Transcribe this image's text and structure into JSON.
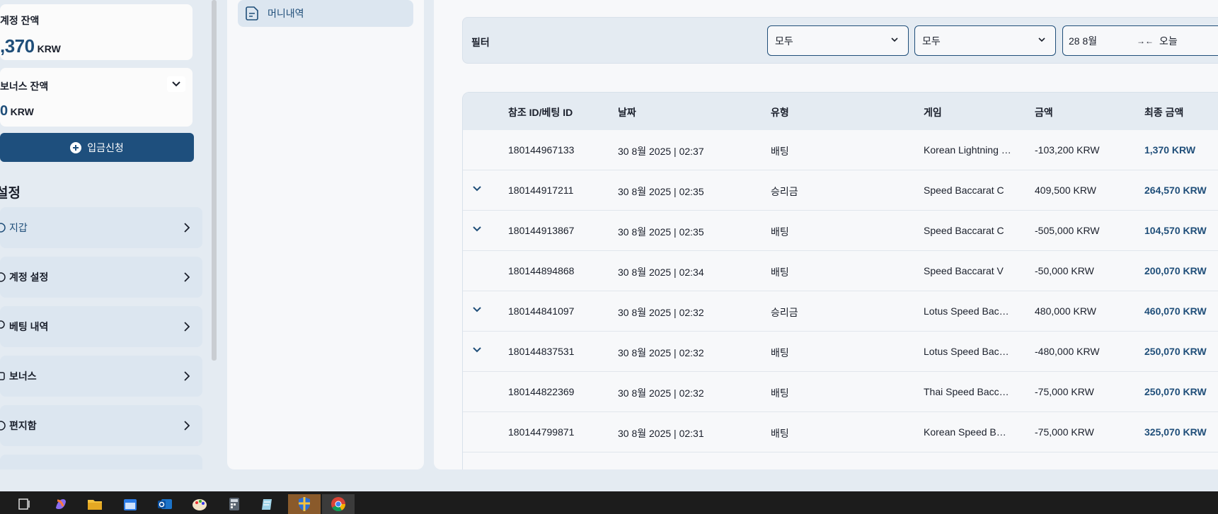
{
  "account": {
    "balance_label": "계정 잔액",
    "balance_value": ",370",
    "currency": "KRW",
    "bonus_label": "보너스 잔액",
    "bonus_value": "0",
    "bonus_currency": "KRW",
    "deposit_button": "입금신청"
  },
  "settings_title": "설정",
  "menu": [
    {
      "label": "지갑",
      "icon": "wallet-icon"
    },
    {
      "label": "계정 설정",
      "icon": "user-icon"
    },
    {
      "label": "베팅 내역",
      "icon": "history-icon"
    },
    {
      "label": "보너스",
      "icon": "gift-icon"
    },
    {
      "label": "편지함",
      "icon": "mail-icon"
    }
  ],
  "middle": {
    "money_history": "머니내역"
  },
  "filter": {
    "label": "필터",
    "select1": "모두",
    "select2": "모두",
    "date_from": "28 8월",
    "date_to": "오늘"
  },
  "table": {
    "headers": [
      "참조 ID/베팅 ID",
      "날짜",
      "유형",
      "게임",
      "금액",
      "최종 금액"
    ],
    "rows": [
      {
        "id": "180144967133",
        "date": "30 8월 2025 | 02:37",
        "type": "배팅",
        "game": "Korean Lightning Baccarat",
        "amount": "-103,200 KRW",
        "final": "1,370 KRW",
        "expandable": false
      },
      {
        "id": "180144917211",
        "date": "30 8월 2025 | 02:35",
        "type": "승리금",
        "game": "Speed Baccarat C",
        "amount": "409,500 KRW",
        "final": "264,570 KRW",
        "expandable": true
      },
      {
        "id": "180144913867",
        "date": "30 8월 2025 | 02:35",
        "type": "배팅",
        "game": "Speed Baccarat C",
        "amount": "-505,000 KRW",
        "final": "104,570 KRW",
        "expandable": true
      },
      {
        "id": "180144894868",
        "date": "30 8월 2025 | 02:34",
        "type": "배팅",
        "game": "Speed Baccarat V",
        "amount": "-50,000 KRW",
        "final": "200,070 KRW",
        "expandable": false
      },
      {
        "id": "180144841097",
        "date": "30 8월 2025 | 02:32",
        "type": "승리금",
        "game": "Lotus Speed Baccarat",
        "amount": "480,000 KRW",
        "final": "460,070 KRW",
        "expandable": true
      },
      {
        "id": "180144837531",
        "date": "30 8월 2025 | 02:32",
        "type": "배팅",
        "game": "Lotus Speed Baccarat",
        "amount": "-480,000 KRW",
        "final": "250,070 KRW",
        "expandable": true
      },
      {
        "id": "180144822369",
        "date": "30 8월 2025 | 02:32",
        "type": "배팅",
        "game": "Thai Speed Baccarat",
        "amount": "-75,000 KRW",
        "final": "250,070 KRW",
        "expandable": false
      },
      {
        "id": "180144799871",
        "date": "30 8월 2025 | 02:31",
        "type": "배팅",
        "game": "Korean Speed Baccarat",
        "amount": "-75,000 KRW",
        "final": "325,070 KRW",
        "expandable": false
      }
    ]
  },
  "colors": {
    "accent": "#1f4e79",
    "panel": "#f7f8fa",
    "background": "#e4ebf2",
    "taskbar": "#1c1c1c"
  },
  "taskbar": [
    "task-view-icon",
    "copilot-icon",
    "file-explorer-icon",
    "calendar-icon",
    "outlook-icon",
    "paint-icon",
    "calculator-icon",
    "notepad-icon",
    "security-icon",
    "chrome-icon"
  ]
}
